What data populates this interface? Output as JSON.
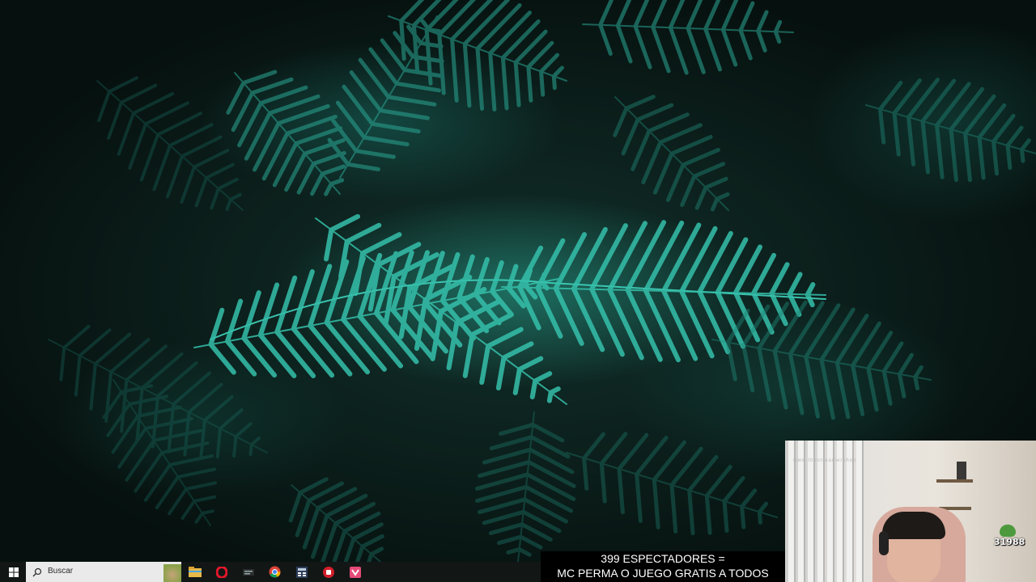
{
  "taskbar": {
    "search_placeholder": "Buscar",
    "icons": [
      "windows-start-icon",
      "search-icon",
      "file-explorer-icon",
      "opera-browser-icon",
      "app-icon",
      "chrome-browser-icon",
      "calculator-icon",
      "red-app-icon",
      "pink-app-icon"
    ]
  },
  "overlay": {
    "line1": "399 ESPECTADORES =",
    "line2": "MC PERMA O JUEGO GRATIS A TODOS"
  },
  "webcam": {
    "watermark": "www.thestreamershop",
    "score": "31988"
  },
  "colors": {
    "fern_accent": "#36c9b4",
    "background_dark": "#0b1a17",
    "taskbar": "#121716"
  }
}
